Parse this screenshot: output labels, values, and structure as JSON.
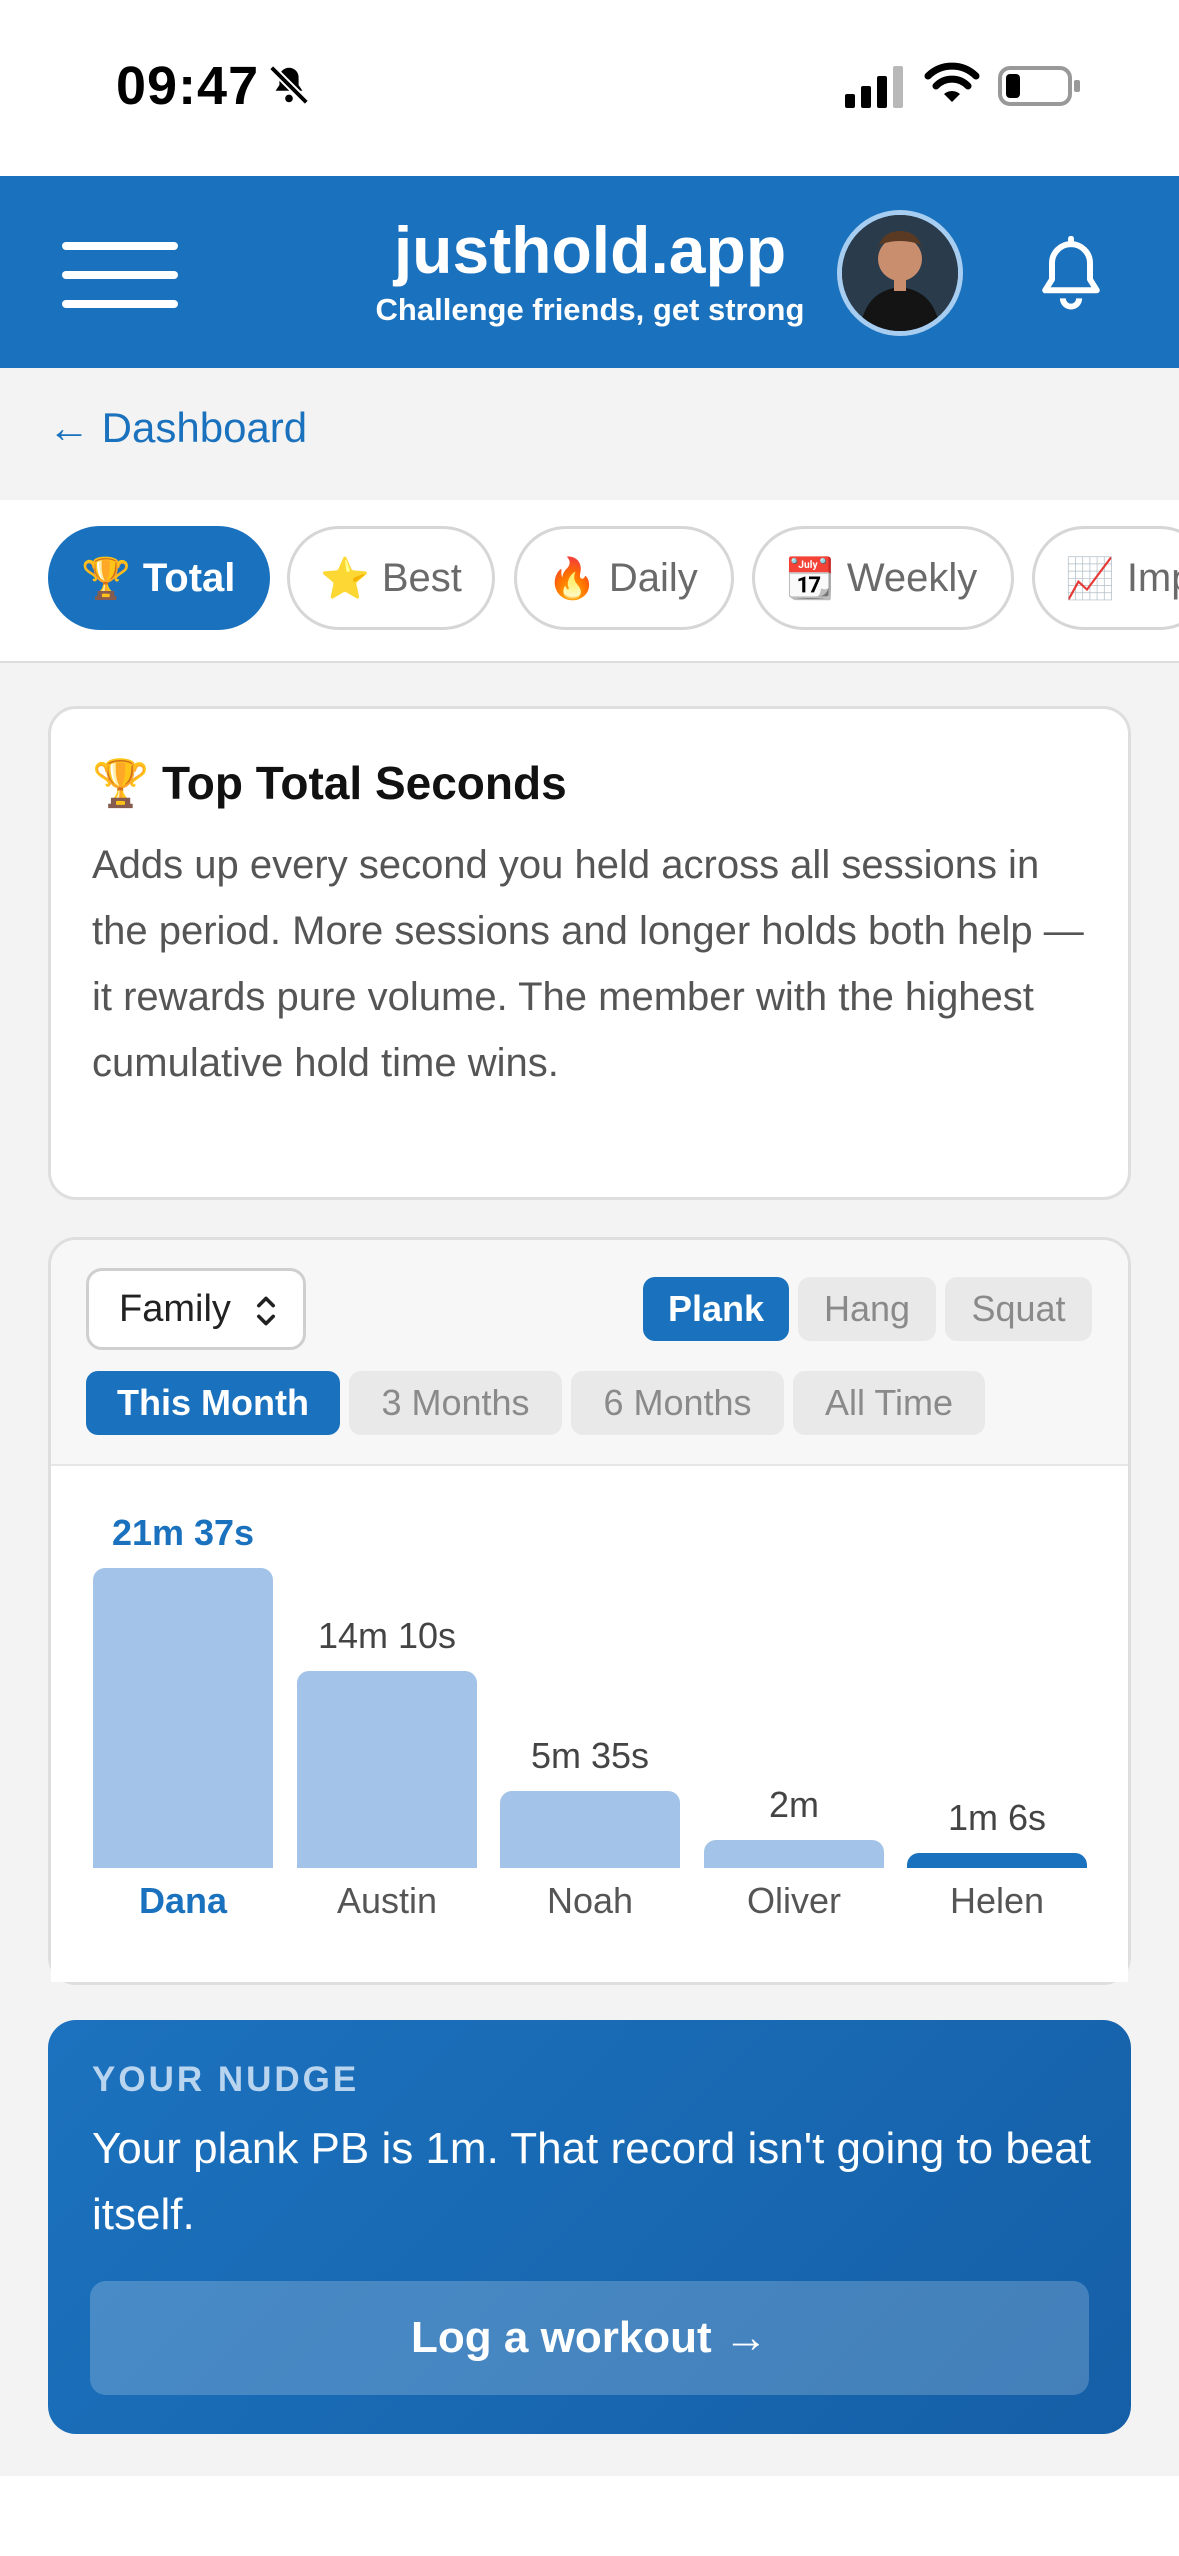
{
  "status_bar": {
    "time": "09:47",
    "icons": [
      "bell-slash-icon",
      "cellular-signal-icon",
      "wifi-icon",
      "battery-icon"
    ]
  },
  "header": {
    "title": "justhold.app",
    "subtitle": "Challenge friends, get strong",
    "icons": [
      "hamburger-menu-icon",
      "avatar",
      "bell-icon"
    ],
    "bg_color": "#1a71bd"
  },
  "nav": {
    "back_label": "← Dashboard"
  },
  "tabs": [
    {
      "emoji": "🏆",
      "label": "Total",
      "active": true
    },
    {
      "emoji": "⭐",
      "label": "Best",
      "active": false
    },
    {
      "emoji": "🔥",
      "label": "Daily",
      "active": false
    },
    {
      "emoji": "📆",
      "label": "Weekly",
      "active": false
    },
    {
      "emoji": "📈",
      "label": "Improvement",
      "active": false
    }
  ],
  "info": {
    "title": "🏆 Top Total Seconds",
    "body": "Adds up every second you held across all sessions in the period. More sessions and longer holds both help — it rewards pure volume. The member with the highest cumulative hold time wins."
  },
  "filters": {
    "group_select": "Family",
    "exercises": [
      {
        "label": "Plank",
        "active": true
      },
      {
        "label": "Hang",
        "active": false
      },
      {
        "label": "Squat",
        "active": false
      }
    ],
    "periods": [
      {
        "label": "This Month",
        "active": true
      },
      {
        "label": "3 Months",
        "active": false
      },
      {
        "label": "6 Months",
        "active": false
      },
      {
        "label": "All Time",
        "active": false
      }
    ]
  },
  "chart_data": {
    "type": "bar",
    "categories": [
      "Dana",
      "Austin",
      "Noah",
      "Oliver",
      "Helen"
    ],
    "values": [
      1297,
      850,
      335,
      120,
      66
    ],
    "value_labels": [
      "21m 37s",
      "14m 10s",
      "5m 35s",
      "2m",
      "1m 6s"
    ],
    "unit": "seconds",
    "highlight_index": 0
  },
  "nudge": {
    "kicker": "YOUR NUDGE",
    "text": "Your plank PB is 1m. That record isn't going to beat itself.",
    "button_label": "Log a workout →"
  }
}
